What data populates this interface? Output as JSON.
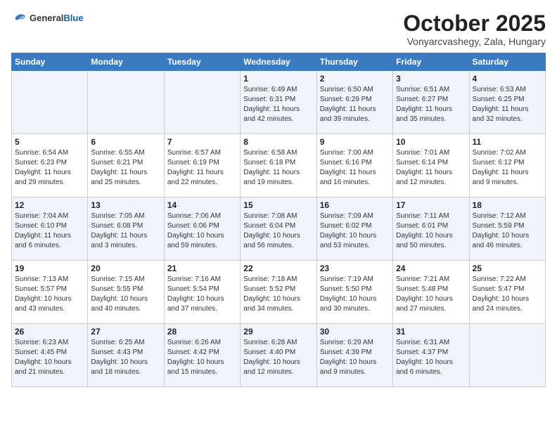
{
  "header": {
    "logo_general": "General",
    "logo_blue": "Blue",
    "month": "October 2025",
    "location": "Vonyarcvashegy, Zala, Hungary"
  },
  "days_of_week": [
    "Sunday",
    "Monday",
    "Tuesday",
    "Wednesday",
    "Thursday",
    "Friday",
    "Saturday"
  ],
  "weeks": [
    [
      {
        "day": "",
        "info": ""
      },
      {
        "day": "",
        "info": ""
      },
      {
        "day": "",
        "info": ""
      },
      {
        "day": "1",
        "info": "Sunrise: 6:49 AM\nSunset: 6:31 PM\nDaylight: 11 hours\nand 42 minutes."
      },
      {
        "day": "2",
        "info": "Sunrise: 6:50 AM\nSunset: 6:29 PM\nDaylight: 11 hours\nand 39 minutes."
      },
      {
        "day": "3",
        "info": "Sunrise: 6:51 AM\nSunset: 6:27 PM\nDaylight: 11 hours\nand 35 minutes."
      },
      {
        "day": "4",
        "info": "Sunrise: 6:53 AM\nSunset: 6:25 PM\nDaylight: 11 hours\nand 32 minutes."
      }
    ],
    [
      {
        "day": "5",
        "info": "Sunrise: 6:54 AM\nSunset: 6:23 PM\nDaylight: 11 hours\nand 29 minutes."
      },
      {
        "day": "6",
        "info": "Sunrise: 6:55 AM\nSunset: 6:21 PM\nDaylight: 11 hours\nand 25 minutes."
      },
      {
        "day": "7",
        "info": "Sunrise: 6:57 AM\nSunset: 6:19 PM\nDaylight: 11 hours\nand 22 minutes."
      },
      {
        "day": "8",
        "info": "Sunrise: 6:58 AM\nSunset: 6:18 PM\nDaylight: 11 hours\nand 19 minutes."
      },
      {
        "day": "9",
        "info": "Sunrise: 7:00 AM\nSunset: 6:16 PM\nDaylight: 11 hours\nand 16 minutes."
      },
      {
        "day": "10",
        "info": "Sunrise: 7:01 AM\nSunset: 6:14 PM\nDaylight: 11 hours\nand 12 minutes."
      },
      {
        "day": "11",
        "info": "Sunrise: 7:02 AM\nSunset: 6:12 PM\nDaylight: 11 hours\nand 9 minutes."
      }
    ],
    [
      {
        "day": "12",
        "info": "Sunrise: 7:04 AM\nSunset: 6:10 PM\nDaylight: 11 hours\nand 6 minutes."
      },
      {
        "day": "13",
        "info": "Sunrise: 7:05 AM\nSunset: 6:08 PM\nDaylight: 11 hours\nand 3 minutes."
      },
      {
        "day": "14",
        "info": "Sunrise: 7:06 AM\nSunset: 6:06 PM\nDaylight: 10 hours\nand 59 minutes."
      },
      {
        "day": "15",
        "info": "Sunrise: 7:08 AM\nSunset: 6:04 PM\nDaylight: 10 hours\nand 56 minutes."
      },
      {
        "day": "16",
        "info": "Sunrise: 7:09 AM\nSunset: 6:02 PM\nDaylight: 10 hours\nand 53 minutes."
      },
      {
        "day": "17",
        "info": "Sunrise: 7:11 AM\nSunset: 6:01 PM\nDaylight: 10 hours\nand 50 minutes."
      },
      {
        "day": "18",
        "info": "Sunrise: 7:12 AM\nSunset: 5:59 PM\nDaylight: 10 hours\nand 46 minutes."
      }
    ],
    [
      {
        "day": "19",
        "info": "Sunrise: 7:13 AM\nSunset: 5:57 PM\nDaylight: 10 hours\nand 43 minutes."
      },
      {
        "day": "20",
        "info": "Sunrise: 7:15 AM\nSunset: 5:55 PM\nDaylight: 10 hours\nand 40 minutes."
      },
      {
        "day": "21",
        "info": "Sunrise: 7:16 AM\nSunset: 5:54 PM\nDaylight: 10 hours\nand 37 minutes."
      },
      {
        "day": "22",
        "info": "Sunrise: 7:18 AM\nSunset: 5:52 PM\nDaylight: 10 hours\nand 34 minutes."
      },
      {
        "day": "23",
        "info": "Sunrise: 7:19 AM\nSunset: 5:50 PM\nDaylight: 10 hours\nand 30 minutes."
      },
      {
        "day": "24",
        "info": "Sunrise: 7:21 AM\nSunset: 5:48 PM\nDaylight: 10 hours\nand 27 minutes."
      },
      {
        "day": "25",
        "info": "Sunrise: 7:22 AM\nSunset: 5:47 PM\nDaylight: 10 hours\nand 24 minutes."
      }
    ],
    [
      {
        "day": "26",
        "info": "Sunrise: 6:23 AM\nSunset: 4:45 PM\nDaylight: 10 hours\nand 21 minutes."
      },
      {
        "day": "27",
        "info": "Sunrise: 6:25 AM\nSunset: 4:43 PM\nDaylight: 10 hours\nand 18 minutes."
      },
      {
        "day": "28",
        "info": "Sunrise: 6:26 AM\nSunset: 4:42 PM\nDaylight: 10 hours\nand 15 minutes."
      },
      {
        "day": "29",
        "info": "Sunrise: 6:28 AM\nSunset: 4:40 PM\nDaylight: 10 hours\nand 12 minutes."
      },
      {
        "day": "30",
        "info": "Sunrise: 6:29 AM\nSunset: 4:39 PM\nDaylight: 10 hours\nand 9 minutes."
      },
      {
        "day": "31",
        "info": "Sunrise: 6:31 AM\nSunset: 4:37 PM\nDaylight: 10 hours\nand 6 minutes."
      },
      {
        "day": "",
        "info": ""
      }
    ]
  ]
}
